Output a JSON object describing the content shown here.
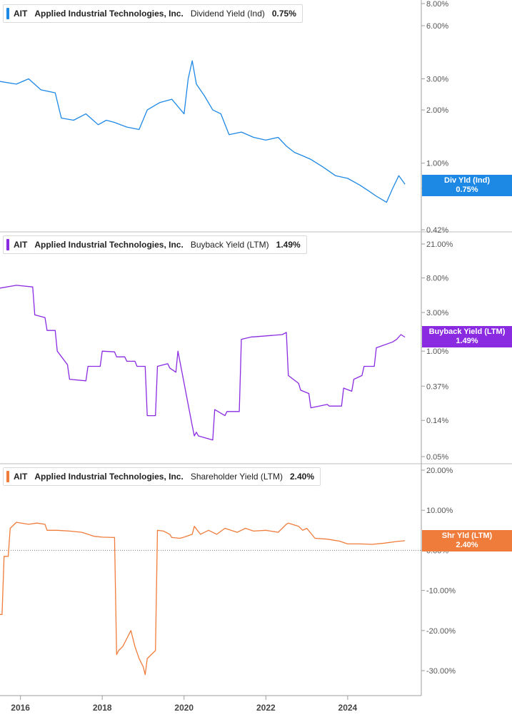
{
  "chart_data": [
    {
      "type": "line",
      "ticker": "AIT",
      "company": "Applied Industrial Technologies, Inc.",
      "metric": "Dividend Yield (Ind)",
      "current": "0.75%",
      "badge_line1": "Div Yld (Ind)",
      "badge_line2": "0.75%",
      "color": "#1e88e5",
      "scale": "log",
      "ylim": [
        0.42,
        8.0
      ],
      "yticks": [
        "8.00%",
        "6.00%",
        "3.00%",
        "2.00%",
        "1.00%",
        "0.72%",
        "0.42%"
      ],
      "ytick_values": [
        8.0,
        6.0,
        3.0,
        2.0,
        1.0,
        0.72,
        0.42
      ],
      "x": [
        2015.5,
        2015.9,
        2016.2,
        2016.5,
        2016.85,
        2017.0,
        2017.3,
        2017.6,
        2017.9,
        2018.1,
        2018.3,
        2018.6,
        2018.9,
        2019.1,
        2019.4,
        2019.7,
        2020.0,
        2020.1,
        2020.2,
        2020.3,
        2020.5,
        2020.7,
        2020.9,
        2021.1,
        2021.4,
        2021.7,
        2022.0,
        2022.3,
        2022.5,
        2022.7,
        2022.9,
        2023.1,
        2023.4,
        2023.7,
        2024.0,
        2024.3,
        2024.5,
        2024.7,
        2024.85,
        2024.95,
        2025.1,
        2025.25,
        2025.4
      ],
      "y": [
        2.9,
        2.8,
        3.0,
        2.6,
        2.5,
        1.8,
        1.75,
        1.9,
        1.65,
        1.75,
        1.7,
        1.6,
        1.55,
        2.0,
        2.2,
        2.3,
        1.9,
        3.0,
        3.8,
        2.8,
        2.4,
        2.0,
        1.9,
        1.45,
        1.5,
        1.4,
        1.35,
        1.4,
        1.25,
        1.15,
        1.1,
        1.05,
        0.95,
        0.85,
        0.82,
        0.75,
        0.7,
        0.65,
        0.62,
        0.6,
        0.72,
        0.85,
        0.76
      ]
    },
    {
      "type": "line",
      "ticker": "AIT",
      "company": "Applied Industrial Technologies, Inc.",
      "metric": "Buyback Yield (LTM)",
      "current": "1.49%",
      "badge_line1": "Buyback Yield (LTM)",
      "badge_line2": "1.49%",
      "color": "#8a2be2",
      "scale": "log",
      "ylim": [
        0.05,
        21.0
      ],
      "yticks": [
        "21.00%",
        "8.00%",
        "3.00%",
        "1.00%",
        "0.37%",
        "0.14%",
        "0.05%"
      ],
      "ytick_values": [
        21.0,
        8.0,
        3.0,
        1.0,
        0.37,
        0.14,
        0.05
      ],
      "x": [
        2015.5,
        2015.9,
        2016.3,
        2016.35,
        2016.6,
        2016.65,
        2016.85,
        2016.9,
        2017.15,
        2017.2,
        2017.6,
        2017.65,
        2017.95,
        2018.0,
        2018.3,
        2018.35,
        2018.55,
        2018.6,
        2018.8,
        2018.85,
        2019.05,
        2019.1,
        2019.3,
        2019.35,
        2019.6,
        2019.65,
        2019.8,
        2019.85,
        2020.2,
        2020.25,
        2020.3,
        2020.35,
        2020.7,
        2020.75,
        2021.0,
        2021.05,
        2021.35,
        2021.4,
        2021.65,
        2021.7,
        2022.4,
        2022.5,
        2022.55,
        2022.8,
        2022.85,
        2023.05,
        2023.1,
        2023.5,
        2023.55,
        2023.85,
        2023.9,
        2024.1,
        2024.15,
        2024.35,
        2024.4,
        2024.65,
        2024.7,
        2025.1,
        2025.2,
        2025.3,
        2025.4
      ],
      "y": [
        6.0,
        6.5,
        6.2,
        2.8,
        2.6,
        1.8,
        1.8,
        1.0,
        0.68,
        0.45,
        0.43,
        0.65,
        0.65,
        1.0,
        0.98,
        0.85,
        0.85,
        0.75,
        0.75,
        0.65,
        0.65,
        0.16,
        0.16,
        0.65,
        0.7,
        0.62,
        0.55,
        1.0,
        0.12,
        0.09,
        0.1,
        0.09,
        0.08,
        0.19,
        0.16,
        0.18,
        0.18,
        1.4,
        1.5,
        1.5,
        1.6,
        1.7,
        0.5,
        0.4,
        0.33,
        0.3,
        0.2,
        0.22,
        0.21,
        0.21,
        0.35,
        0.32,
        0.45,
        0.5,
        0.65,
        0.65,
        1.1,
        1.3,
        1.4,
        1.6,
        1.49
      ]
    },
    {
      "type": "line",
      "ticker": "AIT",
      "company": "Applied Industrial Technologies, Inc.",
      "metric": "Shareholder Yield (LTM)",
      "current": "2.40%",
      "badge_line1": "Shr Yld (LTM)",
      "badge_line2": "2.40%",
      "color": "#f07c3c",
      "scale": "linear",
      "ylim": [
        -33,
        20
      ],
      "yticks": [
        "20.00%",
        "10.00%",
        "0.00%",
        "-10.00%",
        "-20.00%",
        "-30.00%"
      ],
      "ytick_values": [
        20,
        10,
        0,
        -10,
        -20,
        -30
      ],
      "zero_line": true,
      "x": [
        2015.5,
        2015.55,
        2015.6,
        2015.7,
        2015.75,
        2015.9,
        2016.2,
        2016.4,
        2016.6,
        2016.65,
        2016.9,
        2017.2,
        2017.5,
        2017.8,
        2018.0,
        2018.3,
        2018.35,
        2018.4,
        2018.5,
        2018.6,
        2018.7,
        2018.8,
        2018.9,
        2019.0,
        2019.05,
        2019.1,
        2019.2,
        2019.3,
        2019.35,
        2019.5,
        2019.65,
        2019.7,
        2019.9,
        2020.0,
        2020.2,
        2020.25,
        2020.4,
        2020.6,
        2020.8,
        2021.0,
        2021.3,
        2021.5,
        2021.7,
        2022.0,
        2022.3,
        2022.5,
        2022.55,
        2022.8,
        2022.9,
        2023.0,
        2023.2,
        2023.5,
        2023.8,
        2024.0,
        2024.3,
        2024.6,
        2024.9,
        2025.2,
        2025.4
      ],
      "y": [
        -16,
        -16,
        -1.5,
        -1.5,
        5.5,
        7.0,
        6.5,
        6.8,
        6.5,
        5.0,
        5.0,
        4.8,
        4.5,
        3.5,
        3.3,
        3.2,
        -26,
        -25,
        -24,
        -22,
        -20,
        -24,
        -27,
        -29,
        -31,
        -27,
        -26,
        -25,
        5.0,
        4.8,
        4.0,
        3.2,
        3.0,
        3.3,
        4.0,
        6.0,
        4.0,
        5.0,
        4.0,
        5.5,
        4.5,
        5.5,
        4.8,
        5.0,
        4.5,
        6.5,
        6.8,
        6.0,
        5.0,
        5.5,
        3.0,
        2.8,
        2.3,
        1.6,
        1.6,
        1.5,
        1.8,
        2.2,
        2.4
      ]
    }
  ],
  "x_axis": {
    "labels": [
      "2016",
      "2018",
      "2020",
      "2022",
      "2024"
    ],
    "values": [
      2016,
      2018,
      2020,
      2022,
      2024
    ],
    "range": [
      2015.5,
      2025.8
    ]
  }
}
